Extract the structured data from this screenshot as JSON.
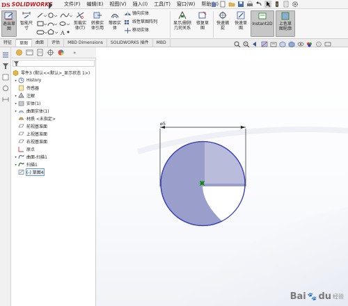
{
  "app": {
    "logo_ds": "DS",
    "logo_name": "SOLIDWORKS"
  },
  "menu": [
    "文件(F)",
    "编辑(E)",
    "视图(V)",
    "插入(I)",
    "工具(T)",
    "窗口(W)",
    "帮助(H)"
  ],
  "command_manager": {
    "exit_sketch": "退出草\n图",
    "smart_dimension": "智能尺\n寸",
    "trim": "剪裁实\n体(T)",
    "convert": "转换实\n体引用",
    "offset": "等距实\n体",
    "mirror": "镜向实体",
    "linear_pattern": "线性草图阵列",
    "move": "移动实体",
    "display_relations": "显示/删除\n几何关系",
    "repair": "修复草\n图",
    "quick_snaps": "快速捕\n捉",
    "rapid_sketch": "快速草\n图",
    "instant2d": "Instant2D",
    "shaded_sketch": "上色草\n图轮廓"
  },
  "tabs": [
    "特征",
    "草图",
    "曲面",
    "评估",
    "MBD Dimensions",
    "SOLIDWORKS 插件",
    "MBD"
  ],
  "active_tab": "草图",
  "tree": {
    "root": "零件3 (默认<<默认>_显示状态 1>)",
    "items": [
      {
        "label": "History",
        "expand": "▸",
        "icon": "history-icon",
        "indent": 1
      },
      {
        "label": "传感器",
        "expand": "",
        "icon": "sensor-icon",
        "indent": 1
      },
      {
        "label": "注解",
        "expand": "▸",
        "icon": "annotation-icon",
        "indent": 1
      },
      {
        "label": "实体(1)",
        "expand": "▸",
        "icon": "solid-body-icon",
        "indent": 1
      },
      {
        "label": "曲面实体(1)",
        "expand": "▸",
        "icon": "surface-body-icon",
        "indent": 1
      },
      {
        "label": "材质 <未指定>",
        "expand": "",
        "icon": "material-icon",
        "indent": 1
      },
      {
        "label": "前视基准面",
        "expand": "",
        "icon": "plane-icon",
        "indent": 1
      },
      {
        "label": "上视基准面",
        "expand": "",
        "icon": "plane-icon",
        "indent": 1
      },
      {
        "label": "右视基准面",
        "expand": "",
        "icon": "plane-icon",
        "indent": 1
      },
      {
        "label": "原点",
        "expand": "",
        "icon": "origin-icon",
        "indent": 1
      },
      {
        "label": "曲面-扫描1",
        "expand": "▸",
        "icon": "sweep-surface-icon",
        "indent": 1
      },
      {
        "label": "扫描1",
        "expand": "▸",
        "icon": "sweep-icon",
        "indent": 1
      },
      {
        "label": "(-) 草图4",
        "expand": "",
        "icon": "sketch-icon",
        "indent": 1,
        "selected": true
      }
    ]
  },
  "sketch": {
    "dimension_label": "⌀5"
  },
  "watermark": {
    "text": "Bai",
    "paw": "du",
    "suffix": "经验"
  },
  "colors": {
    "accent_red": "#c8161d",
    "circle_fill": "#9a9ecb",
    "circle_stroke": "#3a3fbf",
    "origin_green": "#1fa31f"
  }
}
